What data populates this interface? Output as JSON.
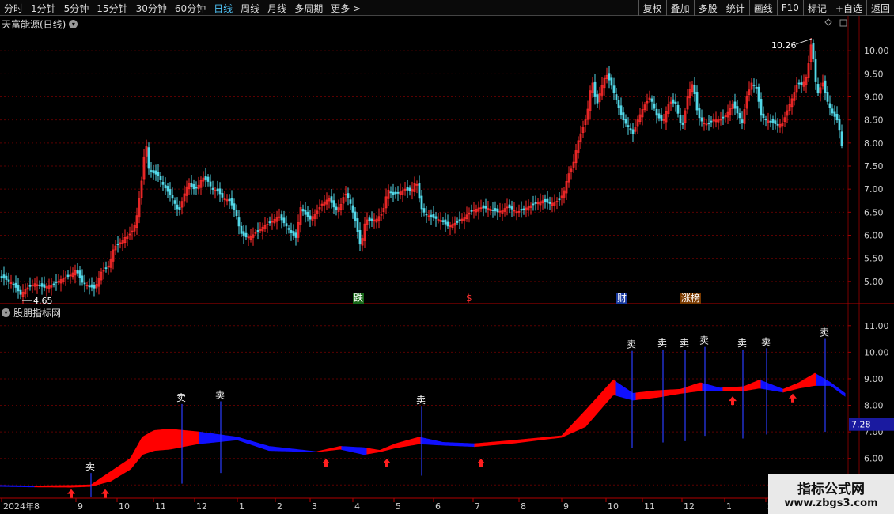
{
  "toolbar": {
    "periods": [
      "分时",
      "1分钟",
      "5分钟",
      "15分钟",
      "30分钟",
      "60分钟",
      "日线",
      "周线",
      "月线",
      "多周期",
      "更多 >"
    ],
    "active_period": "日线",
    "actions": [
      "复权",
      "叠加",
      "多股",
      "统计",
      "画线",
      "F10",
      "标记",
      "+自选",
      "返回"
    ]
  },
  "main_panel": {
    "title": "天富能源(日线)",
    "high_label": "10.26",
    "low_label": "4.65",
    "y_ticks": [
      "10.00",
      "9.50",
      "9.00",
      "8.50",
      "8.00",
      "7.50",
      "7.00",
      "6.50",
      "6.00",
      "5.50",
      "5.00"
    ],
    "events": [
      "跌",
      "$",
      "财",
      "涨榜"
    ]
  },
  "indicator_panel": {
    "title": "股朋指标网",
    "y_ticks": [
      "11.00",
      "10.00",
      "9.00",
      "8.00",
      "7.00",
      "6.00",
      "5.00"
    ],
    "current_value": "7.28",
    "sell_label": "卖"
  },
  "x_axis": {
    "labels": [
      "2024年8",
      "9",
      "10",
      "11",
      "12",
      "1",
      "2",
      "3",
      "4",
      "5",
      "6",
      "7",
      "8",
      "9",
      "10",
      "11",
      "12",
      "1",
      "2"
    ]
  },
  "watermark": {
    "line1": "指标公式网",
    "line2": "www.zbgs3.com"
  },
  "colors": {
    "up": "#ff2a2a",
    "down": "#52d8e8",
    "fill_up": "#ff0000",
    "fill_down": "#1010ff",
    "grid": "#5a0000",
    "axis_text": "#d0d0d0"
  },
  "chart_data": {
    "type": "candlestick",
    "y_range_main": [
      4.5,
      10.5
    ],
    "y_range_indicator": [
      4.8,
      11.5
    ],
    "daily_close_path": [
      [
        0,
        5.12
      ],
      [
        10,
        5.02
      ],
      [
        18,
        4.92
      ],
      [
        26,
        4.72
      ],
      [
        34,
        4.85
      ],
      [
        44,
        4.95
      ],
      [
        56,
        4.87
      ],
      [
        66,
        4.92
      ],
      [
        78,
        5.05
      ],
      [
        88,
        5.12
      ],
      [
        96,
        5.25
      ],
      [
        104,
        4.98
      ],
      [
        112,
        4.9
      ],
      [
        120,
        4.85
      ],
      [
        128,
        5.2
      ],
      [
        138,
        5.35
      ],
      [
        144,
        5.75
      ],
      [
        150,
        5.8
      ],
      [
        158,
        5.95
      ],
      [
        166,
        6.05
      ],
      [
        172,
        6.3
      ],
      [
        180,
        7.3
      ],
      [
        184,
        8.1
      ],
      [
        188,
        7.45
      ],
      [
        194,
        7.35
      ],
      [
        200,
        7.3
      ],
      [
        206,
        7.1
      ],
      [
        212,
        6.95
      ],
      [
        218,
        6.8
      ],
      [
        226,
        6.5
      ],
      [
        232,
        6.85
      ],
      [
        238,
        7.15
      ],
      [
        244,
        7.0
      ],
      [
        250,
        7.05
      ],
      [
        256,
        7.25
      ],
      [
        262,
        7.2
      ],
      [
        268,
        7.0
      ],
      [
        276,
        6.95
      ],
      [
        282,
        6.8
      ],
      [
        290,
        6.75
      ],
      [
        298,
        6.5
      ],
      [
        304,
        6.05
      ],
      [
        312,
        5.95
      ],
      [
        318,
        5.98
      ],
      [
        326,
        6.1
      ],
      [
        334,
        6.2
      ],
      [
        344,
        6.3
      ],
      [
        352,
        6.42
      ],
      [
        360,
        6.25
      ],
      [
        368,
        6.05
      ],
      [
        374,
        5.95
      ],
      [
        380,
        6.6
      ],
      [
        386,
        6.45
      ],
      [
        392,
        6.35
      ],
      [
        400,
        6.5
      ],
      [
        408,
        6.7
      ],
      [
        416,
        6.8
      ],
      [
        424,
        6.55
      ],
      [
        430,
        6.62
      ],
      [
        436,
        6.92
      ],
      [
        442,
        6.75
      ],
      [
        450,
        6.25
      ],
      [
        456,
        5.72
      ],
      [
        462,
        6.35
      ],
      [
        468,
        6.3
      ],
      [
        476,
        6.35
      ],
      [
        484,
        6.5
      ],
      [
        490,
        7.0
      ],
      [
        496,
        6.88
      ],
      [
        504,
        6.92
      ],
      [
        512,
        7.0
      ],
      [
        520,
        6.95
      ],
      [
        526,
        7.2
      ],
      [
        532,
        6.6
      ],
      [
        538,
        6.45
      ],
      [
        548,
        6.38
      ],
      [
        558,
        6.32
      ],
      [
        566,
        6.2
      ],
      [
        574,
        6.25
      ],
      [
        584,
        6.35
      ],
      [
        594,
        6.5
      ],
      [
        606,
        6.6
      ],
      [
        618,
        6.58
      ],
      [
        630,
        6.5
      ],
      [
        642,
        6.62
      ],
      [
        654,
        6.5
      ],
      [
        666,
        6.6
      ],
      [
        676,
        6.68
      ],
      [
        686,
        6.75
      ],
      [
        696,
        6.68
      ],
      [
        706,
        6.75
      ],
      [
        712,
        6.9
      ],
      [
        718,
        7.3
      ],
      [
        724,
        7.5
      ],
      [
        730,
        8.0
      ],
      [
        736,
        8.3
      ],
      [
        742,
        8.6
      ],
      [
        748,
        9.4
      ],
      [
        754,
        8.8
      ],
      [
        760,
        9.2
      ],
      [
        766,
        9.5
      ],
      [
        772,
        9.3
      ],
      [
        778,
        9.0
      ],
      [
        786,
        8.55
      ],
      [
        794,
        8.35
      ],
      [
        800,
        8.2
      ],
      [
        806,
        8.5
      ],
      [
        814,
        8.8
      ],
      [
        822,
        9.0
      ],
      [
        830,
        8.6
      ],
      [
        838,
        8.45
      ],
      [
        846,
        8.9
      ],
      [
        854,
        8.85
      ],
      [
        862,
        8.3
      ],
      [
        870,
        9.1
      ],
      [
        876,
        9.3
      ],
      [
        882,
        8.6
      ],
      [
        888,
        8.45
      ],
      [
        894,
        8.4
      ],
      [
        902,
        8.5
      ],
      [
        910,
        8.5
      ],
      [
        918,
        8.6
      ],
      [
        926,
        8.85
      ],
      [
        932,
        8.65
      ],
      [
        938,
        8.45
      ],
      [
        944,
        9.0
      ],
      [
        950,
        9.3
      ],
      [
        956,
        9.2
      ],
      [
        962,
        8.6
      ],
      [
        968,
        8.5
      ],
      [
        976,
        8.45
      ],
      [
        984,
        8.38
      ],
      [
        990,
        8.45
      ],
      [
        996,
        8.75
      ],
      [
        1002,
        9.0
      ],
      [
        1008,
        9.3
      ],
      [
        1014,
        9.25
      ],
      [
        1020,
        9.45
      ],
      [
        1026,
        10.26
      ],
      [
        1030,
        9.4
      ],
      [
        1034,
        9.1
      ],
      [
        1040,
        9.3
      ],
      [
        1046,
        8.9
      ],
      [
        1052,
        8.65
      ],
      [
        1058,
        8.5
      ],
      [
        1062,
        8.2
      ],
      [
        1066,
        7.7
      ]
    ],
    "indicator_band_upper": [
      [
        0,
        4.98
      ],
      [
        40,
        4.96
      ],
      [
        90,
        4.98
      ],
      [
        115,
        5.0
      ],
      [
        140,
        5.5
      ],
      [
        165,
        6.0
      ],
      [
        180,
        6.8
      ],
      [
        195,
        7.05
      ],
      [
        215,
        7.1
      ],
      [
        250,
        7.0
      ],
      [
        300,
        6.8
      ],
      [
        340,
        6.45
      ],
      [
        400,
        6.25
      ],
      [
        430,
        6.45
      ],
      [
        460,
        6.4
      ],
      [
        480,
        6.3
      ],
      [
        500,
        6.55
      ],
      [
        530,
        6.8
      ],
      [
        560,
        6.6
      ],
      [
        600,
        6.55
      ],
      [
        650,
        6.68
      ],
      [
        710,
        6.85
      ],
      [
        740,
        7.8
      ],
      [
        775,
        8.95
      ],
      [
        800,
        8.45
      ],
      [
        830,
        8.55
      ],
      [
        860,
        8.6
      ],
      [
        885,
        8.85
      ],
      [
        910,
        8.65
      ],
      [
        940,
        8.7
      ],
      [
        960,
        8.95
      ],
      [
        990,
        8.6
      ],
      [
        1010,
        8.85
      ],
      [
        1030,
        9.2
      ],
      [
        1050,
        8.85
      ],
      [
        1068,
        8.45
      ]
    ],
    "indicator_band_lower": [
      [
        0,
        4.95
      ],
      [
        40,
        4.93
      ],
      [
        90,
        4.92
      ],
      [
        115,
        4.95
      ],
      [
        140,
        5.15
      ],
      [
        165,
        5.6
      ],
      [
        180,
        6.15
      ],
      [
        195,
        6.3
      ],
      [
        215,
        6.35
      ],
      [
        250,
        6.55
      ],
      [
        300,
        6.7
      ],
      [
        340,
        6.3
      ],
      [
        400,
        6.25
      ],
      [
        430,
        6.35
      ],
      [
        460,
        6.15
      ],
      [
        480,
        6.25
      ],
      [
        500,
        6.4
      ],
      [
        530,
        6.55
      ],
      [
        560,
        6.5
      ],
      [
        600,
        6.45
      ],
      [
        650,
        6.58
      ],
      [
        710,
        6.8
      ],
      [
        740,
        7.2
      ],
      [
        775,
        8.4
      ],
      [
        800,
        8.2
      ],
      [
        830,
        8.3
      ],
      [
        860,
        8.45
      ],
      [
        885,
        8.55
      ],
      [
        910,
        8.55
      ],
      [
        940,
        8.55
      ],
      [
        960,
        8.65
      ],
      [
        990,
        8.5
      ],
      [
        1010,
        8.65
      ],
      [
        1030,
        8.75
      ],
      [
        1050,
        8.75
      ],
      [
        1068,
        8.35
      ]
    ],
    "sell_signals": [
      {
        "x": 115,
        "top": 5.45,
        "bottom": 4.55
      },
      {
        "x": 230,
        "top": 8.05,
        "bottom": 5.05
      },
      {
        "x": 279,
        "top": 8.15,
        "bottom": 5.45
      },
      {
        "x": 533,
        "top": 7.95,
        "bottom": 5.35
      },
      {
        "x": 799,
        "top": 10.05,
        "bottom": 6.4
      },
      {
        "x": 838,
        "top": 10.1,
        "bottom": 6.6
      },
      {
        "x": 866,
        "top": 10.1,
        "bottom": 6.65
      },
      {
        "x": 891,
        "top": 10.2,
        "bottom": 6.85
      },
      {
        "x": 939,
        "top": 10.1,
        "bottom": 6.75
      },
      {
        "x": 969,
        "top": 10.15,
        "bottom": 6.9
      },
      {
        "x": 1043,
        "top": 10.5,
        "bottom": 7.0
      }
    ],
    "buy_signals": [
      {
        "x": 90,
        "y": 4.9
      },
      {
        "x": 133,
        "y": 4.9
      },
      {
        "x": 412,
        "y": 6.05
      },
      {
        "x": 489,
        "y": 6.05
      },
      {
        "x": 608,
        "y": 6.05
      },
      {
        "x": 926,
        "y": 8.4
      },
      {
        "x": 1002,
        "y": 8.5
      }
    ]
  }
}
